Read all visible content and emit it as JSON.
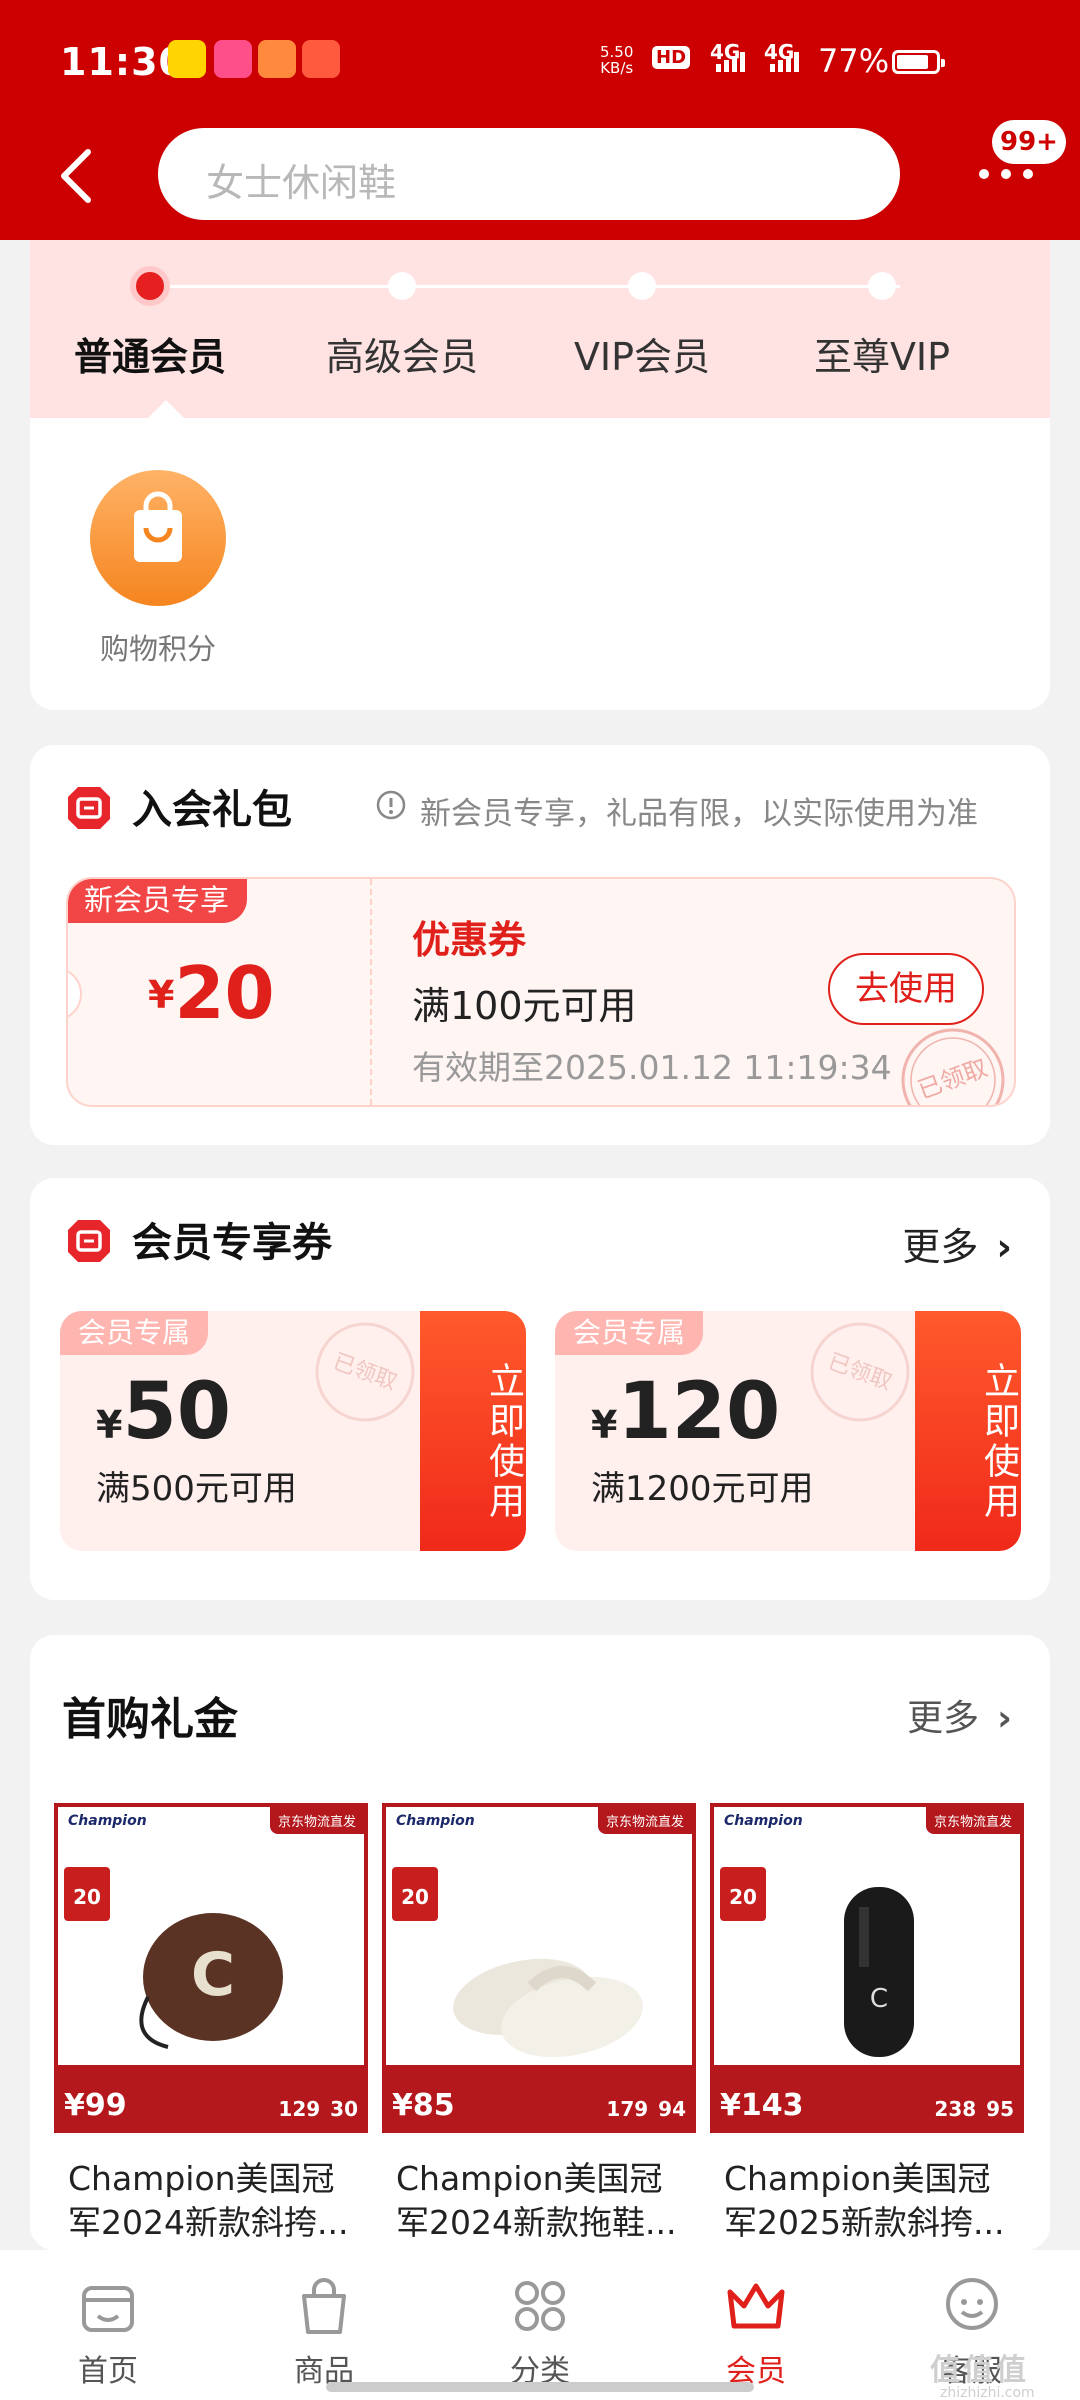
{
  "status_bar": {
    "time": "11:30",
    "net_speed_value": "5.50",
    "net_speed_unit": "KB/s",
    "hd": "HD",
    "sim1": "4G",
    "sim2": "4G",
    "battery": "77%"
  },
  "header": {
    "search_placeholder": "女士休闲鞋",
    "message_badge": "99+"
  },
  "levels": {
    "items": [
      {
        "label": "普通会员",
        "active": true
      },
      {
        "label": "高级会员",
        "active": false
      },
      {
        "label": "VIP会员",
        "active": false
      },
      {
        "label": "至尊VIP",
        "active": false
      }
    ],
    "benefit": {
      "label": "购物积分",
      "icon": "shopping-bag-icon"
    }
  },
  "gift": {
    "title": "入会礼包",
    "note": "新会员专享，礼品有限，以实际使用为准",
    "coupon": {
      "tag": "新会员专享",
      "currency": "¥",
      "amount": "20",
      "title": "优惠券",
      "condition": "满100元可用",
      "validity": "有效期至2025.01.12 11:19:34",
      "button": "去使用",
      "stamp": "已领取"
    }
  },
  "member_coupons": {
    "title": "会员专享券",
    "more": "更多",
    "items": [
      {
        "tag": "会员专属",
        "currency": "¥",
        "amount": "50",
        "condition": "满500元可用",
        "button": "立即使用",
        "stamp": "已领取"
      },
      {
        "tag": "会员专属",
        "currency": "¥",
        "amount": "120",
        "condition": "满1200元可用",
        "button": "立即使用",
        "stamp": "已领取"
      }
    ]
  },
  "first_purchase": {
    "title": "首购礼金",
    "more": "更多",
    "products": [
      {
        "name": "Champion美国冠军2024新款斜挎...",
        "brand": "Champion",
        "ship": "京东物流直发",
        "coupon": "20",
        "price": "99",
        "deal": "129",
        "cut": "30"
      },
      {
        "name": "Champion美国冠军2024新款拖鞋...",
        "brand": "Champion",
        "ship": "京东物流直发",
        "coupon": "20",
        "price": "85",
        "deal": "179",
        "cut": "94"
      },
      {
        "name": "Champion美国冠军2025新款斜挎...",
        "brand": "Champion",
        "ship": "京东物流直发",
        "coupon": "20",
        "price": "143",
        "deal": "238",
        "cut": "95"
      }
    ]
  },
  "tabbar": {
    "items": [
      {
        "label": "首页",
        "icon": "store-icon",
        "active": false
      },
      {
        "label": "商品",
        "icon": "bag-icon",
        "active": false
      },
      {
        "label": "分类",
        "icon": "grid-icon",
        "active": false
      },
      {
        "label": "会员",
        "icon": "crown-icon",
        "active": true
      },
      {
        "label": "客服",
        "icon": "chat-face-icon",
        "active": false
      }
    ]
  },
  "watermark": {
    "text": "值值值",
    "sub": "zhizhizhi.com"
  },
  "colors": {
    "brand_red": "#cc0000",
    "accent_red": "#e0201a",
    "orange": "#f5851f",
    "pink_band": "#ffe3e3"
  }
}
